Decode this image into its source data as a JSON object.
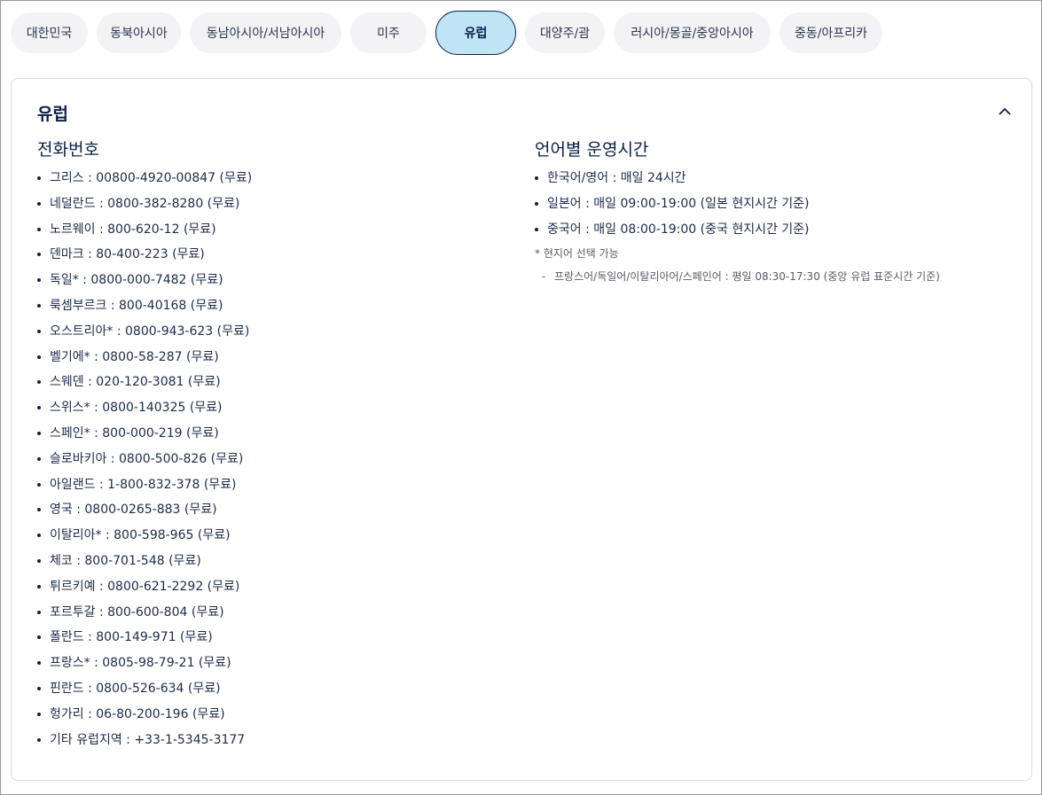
{
  "tabs": [
    {
      "label": "대한민국",
      "active": false
    },
    {
      "label": "동북아시아",
      "active": false
    },
    {
      "label": "동남아시아/서남아시아",
      "active": false
    },
    {
      "label": "미주",
      "active": false
    },
    {
      "label": "유럽",
      "active": true
    },
    {
      "label": "대양주/괌",
      "active": false
    },
    {
      "label": "러시아/몽골/중앙아시아",
      "active": false
    },
    {
      "label": "중동/아프리카",
      "active": false
    }
  ],
  "panel": {
    "title": "유럽",
    "collapse_icon": "chevron-up-icon",
    "phones": {
      "heading": "전화번호",
      "items": [
        "그리스 : 00800-4920-00847 (무료)",
        "네덜란드 : 0800-382-8280 (무료)",
        "노르웨이 : 800-620-12 (무료)",
        "덴마크 : 80-400-223 (무료)",
        "독일* : 0800-000-7482 (무료)",
        "룩셈부르크 : 800-40168 (무료)",
        "오스트리아* : 0800-943-623 (무료)",
        "벨기에* : 0800-58-287 (무료)",
        "스웨덴 : 020-120-3081 (무료)",
        "스위스* : 0800-140325 (무료)",
        "스페인* : 800-000-219 (무료)",
        "슬로바키아 : 0800-500-826 (무료)",
        "아일랜드 : 1-800-832-378 (무료)",
        "영국 : 0800-0265-883 (무료)",
        "이탈리아* : 800-598-965 (무료)",
        "체코 : 800-701-548 (무료)",
        "튀르키예 : 0800-621-2292 (무료)",
        "포르투갈 : 800-600-804 (무료)",
        "폴란드 : 800-149-971 (무료)",
        "프랑스* : 0805-98-79-21 (무료)",
        "핀란드 : 0800-526-634 (무료)",
        "헝가리 : 06-80-200-196 (무료)",
        "기타 유럽지역 : +33-1-5345-3177"
      ]
    },
    "hours": {
      "heading": "언어별 운영시간",
      "items": [
        "한국어/영어 : 매일 24시간",
        "일본어 : 매일 09:00-19:00 (일본 현지시간 기준)",
        "중국어 : 매일 08:00-19:00 (중국 현지시간 기준)"
      ],
      "note": "* 현지어 선택 가능",
      "subnote_dash": "-",
      "subnote": "프랑스어/독일어/이탈리아어/스페인어 : 평일 08:30-17:30 (중앙 유럽 표준시간 기준)"
    }
  },
  "colors": {
    "active_tab_bg": "#bfe4f6",
    "active_tab_border": "#0b1f4a",
    "tab_bg": "#f3f3f5",
    "text": "#1b2a4a"
  }
}
